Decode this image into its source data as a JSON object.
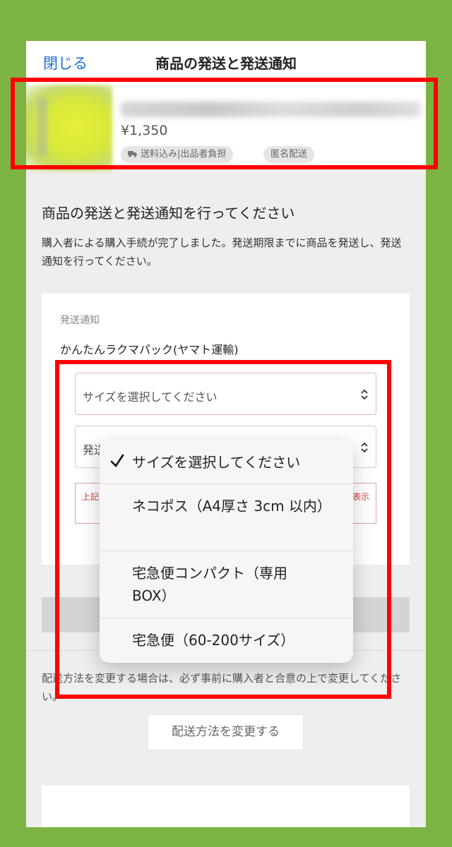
{
  "header": {
    "close_label": "閉じる",
    "title": "商品の発送と発送通知"
  },
  "product": {
    "price": "¥1,350",
    "tags": [
      "送料込み|出品者負担",
      "匿名配送"
    ]
  },
  "section": {
    "title": "商品の発送と発送通知を行ってください",
    "description": "購入者による購入手続が完了しました。発送期限までに商品を発送し、発送通知を行ってください。"
  },
  "form": {
    "label": "発送通知",
    "carrier": "かんたんラクマパック(ヤマト運輸)",
    "size_select_value": "サイズを選択してください",
    "date_select_value": "発送",
    "error_left": "上記",
    "error_right": "表示"
  },
  "dropdown": {
    "options": [
      {
        "label": "サイズを選択してください",
        "selected": true
      },
      {
        "label": "ネコポス（A4厚さ 3cm 以内）",
        "selected": false
      },
      {
        "label": "宅急便コンパクト（専用 BOX）",
        "selected": false
      },
      {
        "label": "宅急便（60-200サイズ）",
        "selected": false
      }
    ]
  },
  "change": {
    "note": "配送方法を変更する場合は、必ず事前に購入者と合意の上で変更してください。",
    "button_label": "配送方法を変更する"
  },
  "colors": {
    "background": "#7db342",
    "highlight": "#ff0000",
    "link": "#1a6fd1"
  },
  "icons": [
    "truck-icon",
    "updown-icon",
    "check-icon"
  ]
}
